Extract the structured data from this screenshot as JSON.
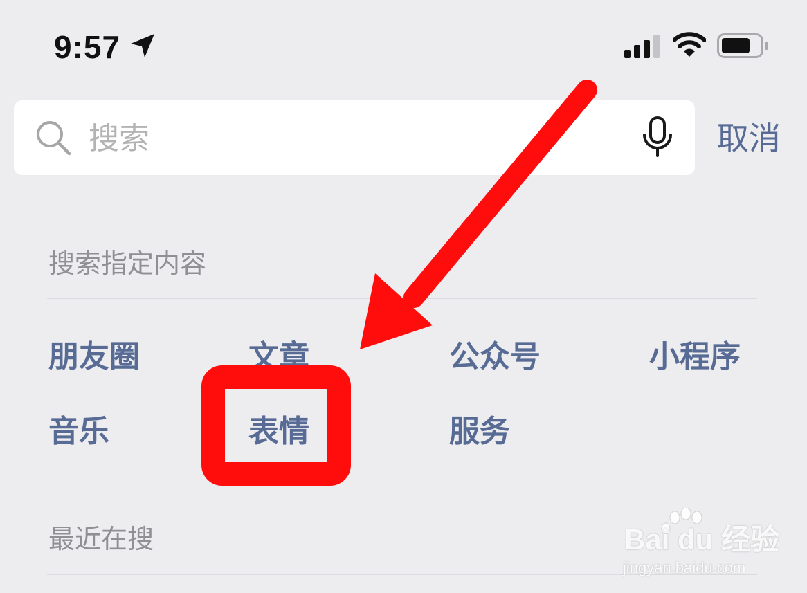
{
  "status_bar": {
    "time": "9:57",
    "icons": [
      "location-arrow-icon",
      "cellular-signal-icon",
      "wifi-icon",
      "battery-icon"
    ]
  },
  "search": {
    "placeholder": "搜索",
    "value": "",
    "cancel_label": "取消"
  },
  "specified_content": {
    "title": "搜索指定内容",
    "categories": [
      {
        "label": "朋友圈"
      },
      {
        "label": "文章"
      },
      {
        "label": "公众号"
      },
      {
        "label": "小程序"
      },
      {
        "label": "音乐"
      },
      {
        "label": "表情"
      },
      {
        "label": "服务"
      }
    ]
  },
  "recent": {
    "title": "最近在搜"
  },
  "watermark": {
    "brand": "Bai du 经验",
    "url": "jingyan.baidu.com"
  },
  "colors": {
    "background": "#ededf0",
    "link_blue": "#576b95",
    "annotation_red": "#ff0d0d"
  }
}
